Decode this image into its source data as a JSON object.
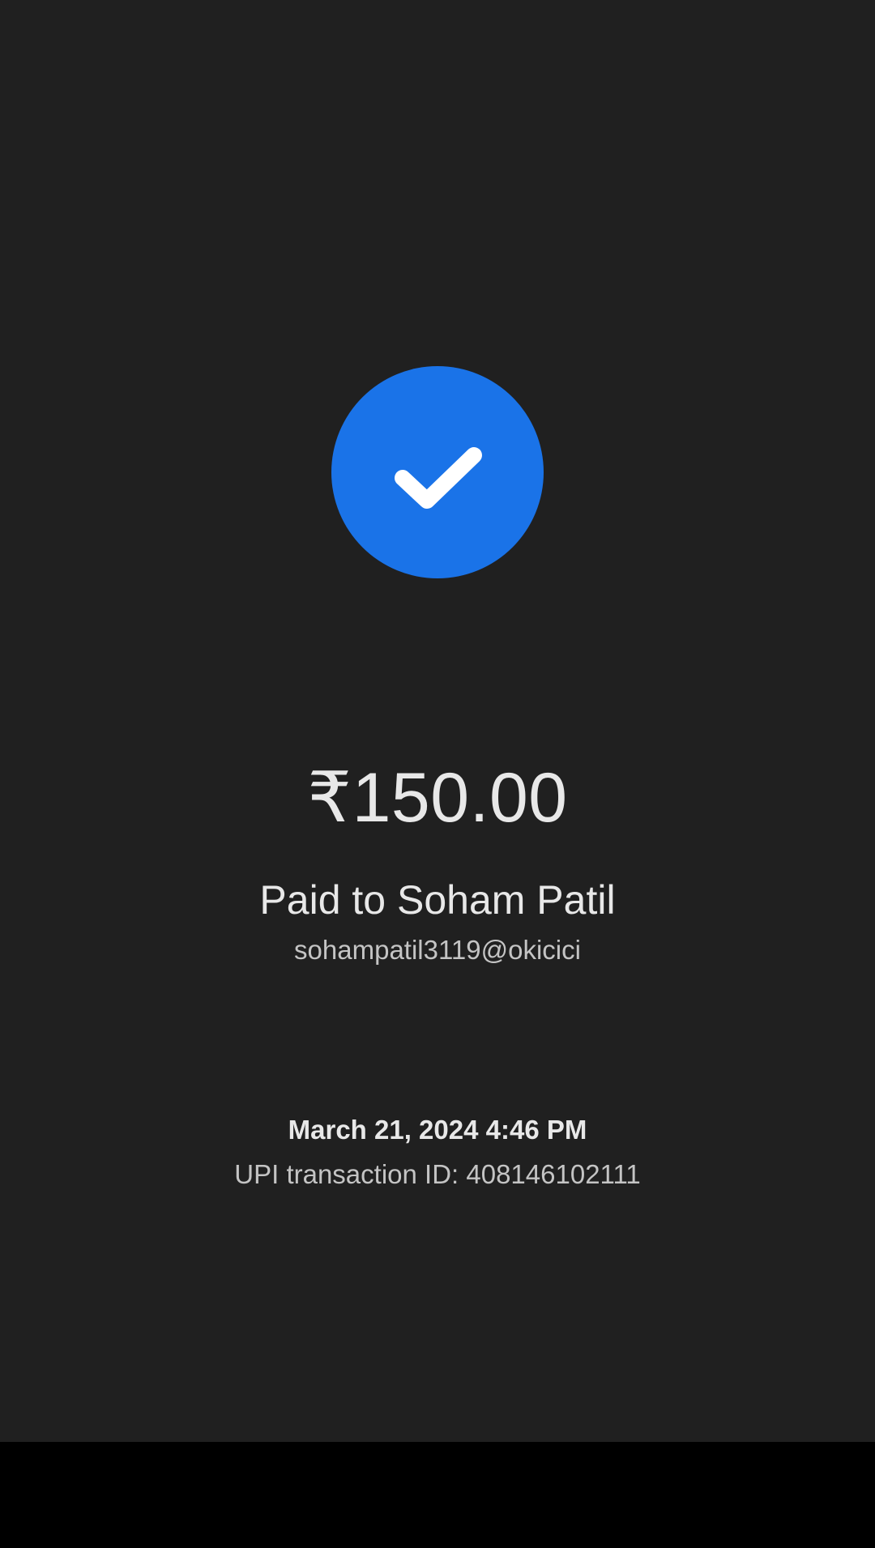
{
  "payment": {
    "status_icon": "check-icon",
    "amount": "₹150.00",
    "payee_line": "Paid to Soham Patil",
    "upi_handle": "sohampatil3119@okicici",
    "timestamp": "March 21, 2024 4:46 PM",
    "transaction_line": "UPI transaction ID: 408146102111"
  },
  "colors": {
    "background": "#202020",
    "accent": "#1a73e8",
    "primary_text": "#e8e8e8",
    "secondary_text": "#c4c4c4",
    "nav_bar": "#000000"
  }
}
